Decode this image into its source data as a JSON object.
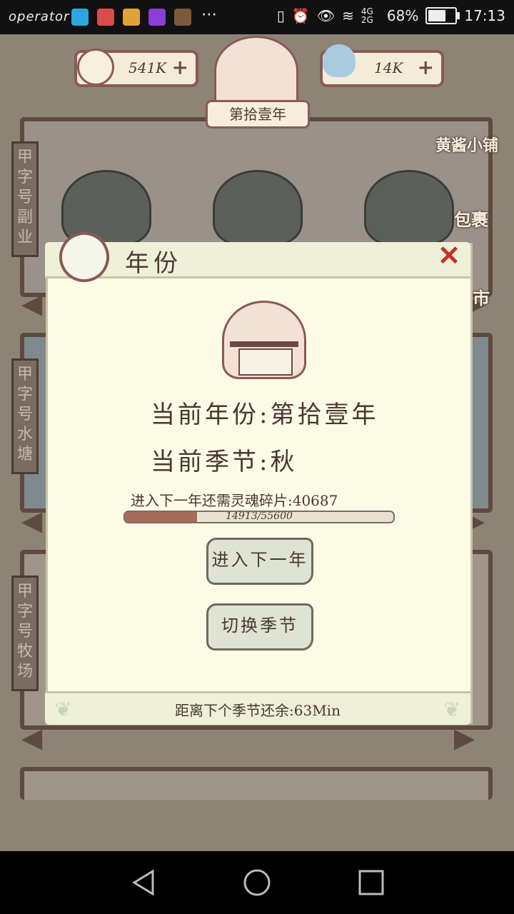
{
  "status_bar": {
    "carrier": "operator",
    "network": "4G 2G",
    "battery": "68%",
    "time": "17:13"
  },
  "resources": {
    "coins": "541K",
    "water": "14K"
  },
  "year_badge": "第拾壹年",
  "shop_label": "黄酱小铺",
  "bag_label": "包裹",
  "market_label": "市",
  "side_tags": [
    "甲字号副业",
    "甲字号水塘",
    "甲字号牧场"
  ],
  "dialog": {
    "title": "年份",
    "current_year_label": "当前年份:第拾壹年",
    "current_season_label": "当前季节:秋",
    "need_text": "进入下一年还需灵魂碎片:40687",
    "progress": {
      "current": 14913,
      "max": 55600,
      "text": "14913/55600",
      "fraction": 0.268
    },
    "next_year_button": "进入下一年",
    "switch_season_button": "切换季节",
    "footer_text": "距离下个季节还余:63Min"
  },
  "colors": {
    "accent_red": "#c2322b",
    "dialog_bg": "#fbfbe6",
    "progress_fill": "#a86a5b"
  }
}
